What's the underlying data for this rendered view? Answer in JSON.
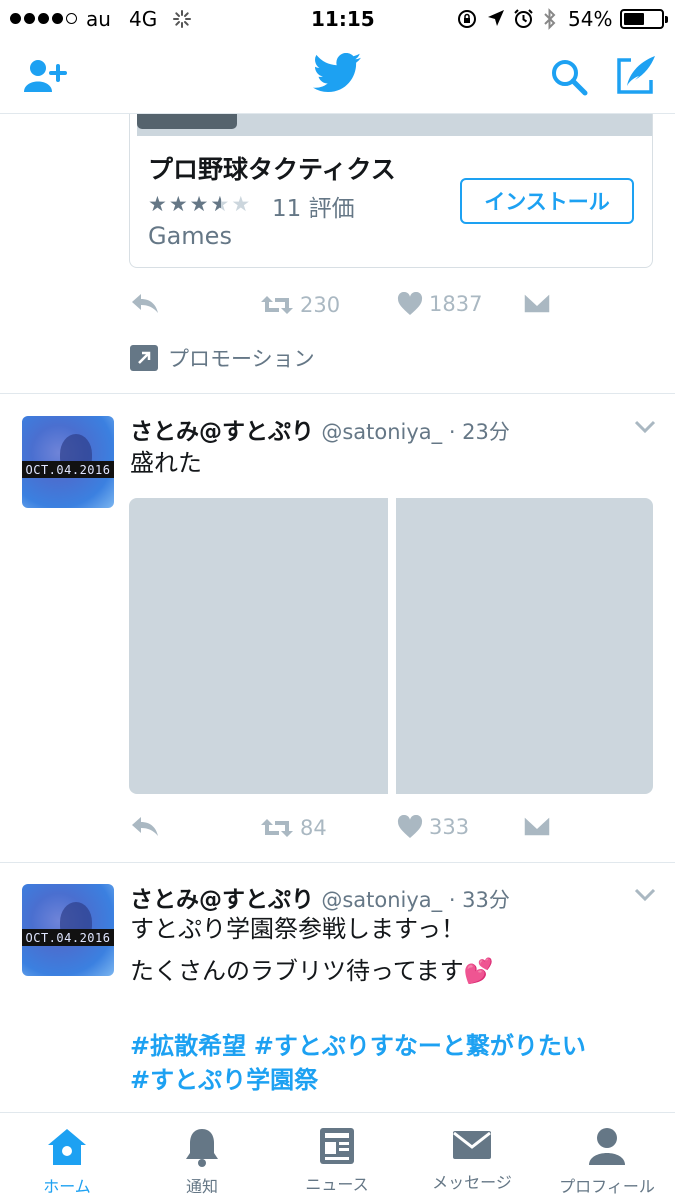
{
  "status_bar": {
    "carrier": "au",
    "network": "4G",
    "time": "11:15",
    "battery": "54%",
    "battery_level": 0.54
  },
  "nav": {
    "add_user_icon": "add-user-icon",
    "logo_icon": "twitter-bird-icon",
    "search_icon": "search-icon",
    "compose_icon": "compose-icon"
  },
  "ad_card": {
    "app_title": "プロ野球タクティクス",
    "stars_display": "★★★",
    "star_rating": 3.5,
    "rating_count": "11 評価",
    "category": "Games",
    "install_label": "インストール",
    "retweets": "230",
    "likes": "1837",
    "promoted_label": "プロモーション"
  },
  "tweets": [
    {
      "name": "さとみ@すとぷり",
      "handle": "@satoniya_ · 23分",
      "avatar_text": "OCT.04.2016",
      "text": "盛れた",
      "retweets": "84",
      "likes": "333"
    },
    {
      "name": "さとみ@すとぷり",
      "handle": "@satoniya_ · 33分",
      "avatar_text": "OCT.04.2016",
      "line1": "すとぷり学園祭参戦しますっ！",
      "line2": "たくさんのラブリツ待ってます",
      "emoji": "💕",
      "hashtag1": "#拡散希望",
      "hashtag2": "#すとぷりすなーと繋がりたい",
      "hashtag3": "#すとぷり学園祭"
    }
  ],
  "tabbar": {
    "items": [
      {
        "label": "ホーム",
        "icon": "home-icon",
        "active": true
      },
      {
        "label": "通知",
        "icon": "bell-icon"
      },
      {
        "label": "ニュース",
        "icon": "news-icon"
      },
      {
        "label": "メッセージ",
        "icon": "mail-icon"
      },
      {
        "label": "プロフィール",
        "icon": "profile-icon"
      }
    ]
  },
  "colors": {
    "accent": "#1da1f2",
    "secondary_text": "#657786",
    "action_gray": "#aab8c2",
    "media_placeholder": "#ccd6dd"
  }
}
